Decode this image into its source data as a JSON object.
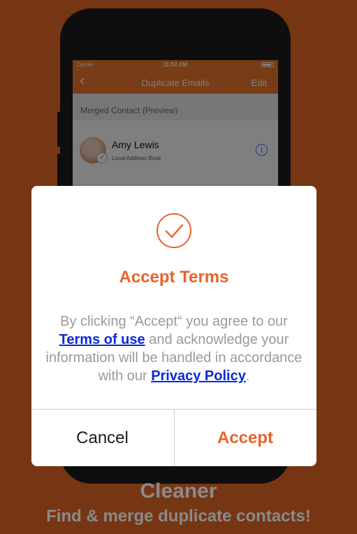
{
  "status_bar": {
    "carrier": "Carrier",
    "time": "11:52 AM"
  },
  "navbar": {
    "back_icon": "chevron-left-icon",
    "title": "Duplicate Emails",
    "edit_label": "Edit"
  },
  "section": {
    "header": "Merged Contact (Preview)"
  },
  "contact": {
    "name": "Amy Lewis",
    "source": "Local Address Book",
    "info_icon": "info-icon"
  },
  "dialog": {
    "icon": "check-circle-icon",
    "title": "Accept Terms",
    "body_prefix": "By clicking “Accept“ you agree to our",
    "terms_link": "Terms of use",
    "body_middle": "and acknowledge your information will be handled in accordance with our",
    "privacy_link": "Privacy Policy",
    "body_suffix": ".",
    "cancel_label": "Cancel",
    "accept_label": "Accept"
  },
  "caption": {
    "title": "Cleaner",
    "subtitle": "Find & merge duplicate contacts!"
  },
  "colors": {
    "accent": "#e8622a",
    "link": "#0a2ad6",
    "navbar": "#f07b2d"
  }
}
